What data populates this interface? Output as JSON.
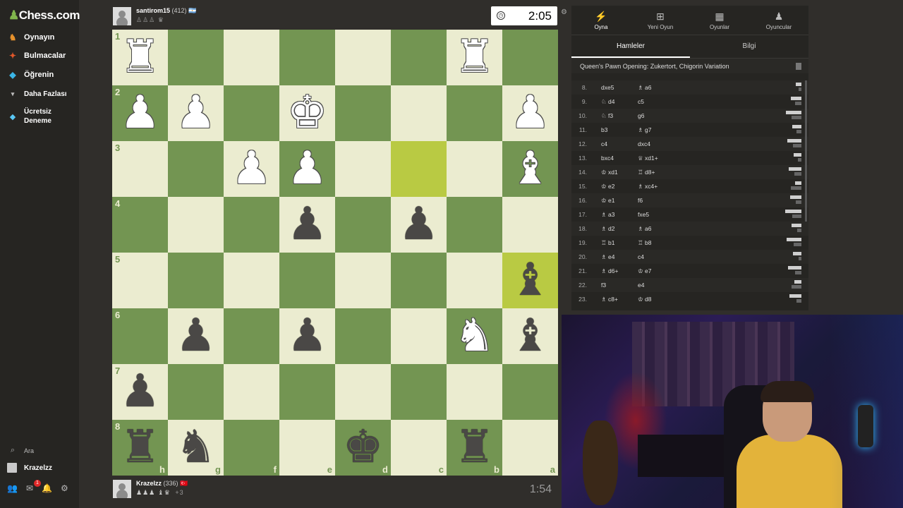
{
  "brand": {
    "name_prefix": "♟",
    "name": "Chess.com"
  },
  "nav": [
    {
      "label": "Oynayın",
      "icon": "play-icon",
      "glyph": "♟",
      "color": "#e6912c"
    },
    {
      "label": "Bulmacalar",
      "icon": "puzzle-icon",
      "glyph": "✦",
      "color": "#e0572a"
    },
    {
      "label": "Öğrenin",
      "icon": "learn-icon",
      "glyph": "🎓",
      "color": "#3ab5e6"
    },
    {
      "label": "Daha Fazlası",
      "icon": "more-chevron-icon",
      "glyph": "⌄",
      "color": "#bbb"
    }
  ],
  "promo": {
    "label_line1": "Ücretsiz",
    "label_line2": "Deneme"
  },
  "search": {
    "label": "Ara"
  },
  "current_user": {
    "name": "Krazelzz"
  },
  "notifications": {
    "count": "1"
  },
  "top_player": {
    "name": "santirom15",
    "rating": "(412)",
    "flag": "🇦🇷",
    "captured": "♙♙♙ ♛",
    "clock": "2:05"
  },
  "bottom_player": {
    "name": "Krazelzz",
    "rating": "(336)",
    "flag": "🇹🇷",
    "captured": "♟♟♟ ♝♛",
    "advantage": "+3",
    "clock": "1:54"
  },
  "board": {
    "rank_labels": [
      "1",
      "2",
      "3",
      "4",
      "5",
      "6",
      "7",
      "8"
    ],
    "file_labels": [
      "h",
      "g",
      "f",
      "e",
      "d",
      "c",
      "b",
      "a"
    ],
    "highlight": [
      [
        2,
        5
      ],
      [
        4,
        7
      ]
    ],
    "rows": [
      [
        "wR",
        "",
        "",
        "",
        "",
        "",
        "wR",
        ""
      ],
      [
        "wP",
        "wP",
        "",
        "wK",
        "",
        "",
        "",
        "wP"
      ],
      [
        "",
        "",
        "wP",
        "wP",
        "",
        "",
        "",
        "wB"
      ],
      [
        "",
        "",
        "",
        "bP",
        "",
        "bP",
        "",
        ""
      ],
      [
        "",
        "",
        "",
        "",
        "",
        "",
        "",
        "bB"
      ],
      [
        "",
        "bP",
        "",
        "bP",
        "",
        "",
        "wN",
        "bB"
      ],
      [
        "bP",
        "",
        "",
        "",
        "",
        "",
        "",
        ""
      ],
      [
        "bR",
        "bN",
        "",
        "",
        "bK",
        "",
        "bR",
        ""
      ]
    ]
  },
  "panel": {
    "tabs": [
      {
        "label": "Oyna",
        "icon": "lightning-icon",
        "glyph": "⚡"
      },
      {
        "label": "Yeni Oyun",
        "icon": "plus-icon",
        "glyph": "⊞"
      },
      {
        "label": "Oyunlar",
        "icon": "board-icon",
        "glyph": "▦"
      },
      {
        "label": "Oyuncular",
        "icon": "players-icon",
        "glyph": "👥"
      }
    ],
    "subtabs": [
      "Hamleler",
      "Bilgi"
    ],
    "opening": "Queen's Pawn Opening: Zukertort, Chigorin Variation",
    "moves": [
      {
        "n": "8.",
        "w": "dxe5",
        "wp": "",
        "b": "a6",
        "bp": "♗"
      },
      {
        "n": "9.",
        "w": "d4",
        "wp": "♘",
        "b": "c5",
        "bp": ""
      },
      {
        "n": "10.",
        "w": "f3",
        "wp": "♘",
        "b": "g6",
        "bp": ""
      },
      {
        "n": "11.",
        "w": "b3",
        "wp": "",
        "b": "g7",
        "bp": "♗"
      },
      {
        "n": "12.",
        "w": "c4",
        "wp": "",
        "b": "dxc4",
        "bp": ""
      },
      {
        "n": "13.",
        "w": "bxc4",
        "wp": "",
        "b": "xd1+",
        "bp": "♕"
      },
      {
        "n": "14.",
        "w": "xd1",
        "wp": "♔",
        "b": "d8+",
        "bp": "♖"
      },
      {
        "n": "15.",
        "w": "e2",
        "wp": "♔",
        "b": "xc4+",
        "bp": "♗"
      },
      {
        "n": "16.",
        "w": "e1",
        "wp": "♔",
        "b": "f6",
        "bp": ""
      },
      {
        "n": "17.",
        "w": "a3",
        "wp": "♗",
        "b": "fxe5",
        "bp": ""
      },
      {
        "n": "18.",
        "w": "d2",
        "wp": "♗",
        "b": "a6",
        "bp": "♗"
      },
      {
        "n": "19.",
        "w": "b1",
        "wp": "♖",
        "b": "b8",
        "bp": "♖"
      },
      {
        "n": "20.",
        "w": "e4",
        "wp": "♗",
        "b": "c4",
        "bp": ""
      },
      {
        "n": "21.",
        "w": "d6+",
        "wp": "♗",
        "b": "e7",
        "bp": "♔"
      },
      {
        "n": "22.",
        "w": "f3",
        "wp": "",
        "b": "e4",
        "bp": ""
      },
      {
        "n": "23.",
        "w": "c8+",
        "wp": "♗",
        "b": "d8",
        "bp": "♔"
      }
    ]
  }
}
